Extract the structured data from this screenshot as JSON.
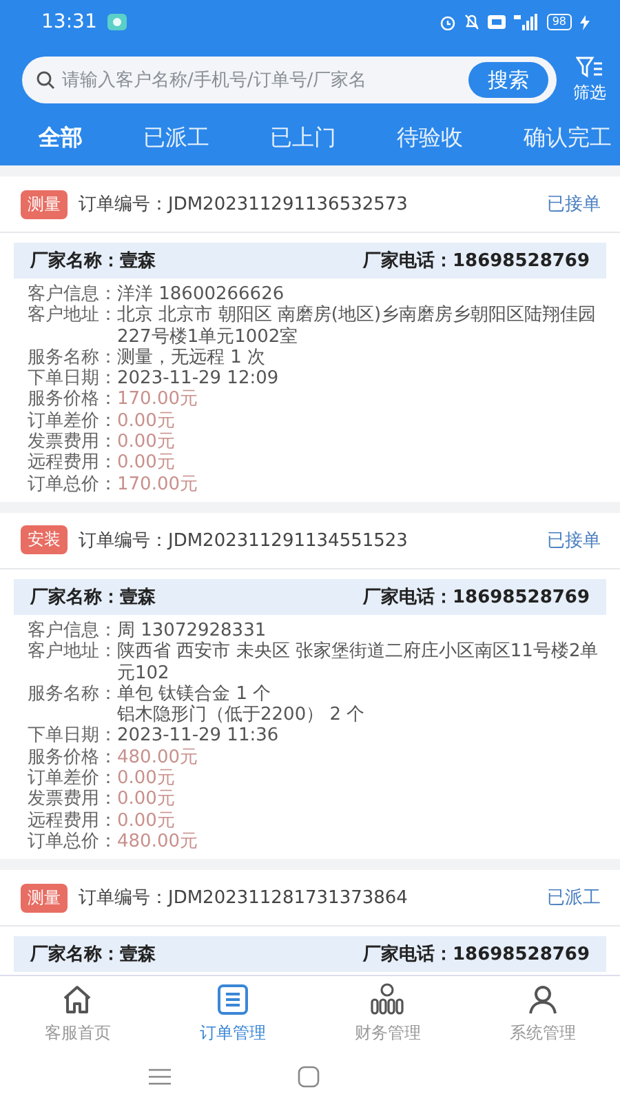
{
  "status_bar": {
    "time": "13:31",
    "battery": "98"
  },
  "search": {
    "placeholder": "请输入客户名称/手机号/订单号/厂家名",
    "button": "搜索",
    "filter_label": "筛选"
  },
  "tabs": [
    {
      "label": "全部",
      "selected": true
    },
    {
      "label": "已派工",
      "selected": false
    },
    {
      "label": "已上门",
      "selected": false
    },
    {
      "label": "待验收",
      "selected": false
    },
    {
      "label": "确认完工",
      "selected": false
    }
  ],
  "orders": [
    {
      "tag": "测量",
      "order_label": "订单编号：",
      "order_no": "JDM202311291136532573",
      "status": "已接单",
      "vendor_label": "厂家名称：",
      "vendor": "壹森",
      "phone_label": "厂家电话：",
      "phone": "18698528769",
      "details": [
        {
          "label": "客户信息：",
          "kind": "text",
          "lines": [
            "洋洋 18600266626"
          ]
        },
        {
          "label": "客户地址：",
          "kind": "text",
          "lines": [
            "北京 北京市 朝阳区 南磨房(地区)乡南磨房乡朝阳区陆翔佳园227号楼1单元1002室"
          ]
        },
        {
          "label": "服务名称：",
          "kind": "text",
          "lines": [
            "测量，无远程 1 次"
          ]
        },
        {
          "label": "下单日期：",
          "kind": "text",
          "lines": [
            "2023-11-29 12:09"
          ]
        },
        {
          "label": "服务价格：",
          "kind": "price",
          "lines": [
            "170.00元"
          ]
        },
        {
          "label": "订单差价：",
          "kind": "price",
          "lines": [
            "0.00元"
          ]
        },
        {
          "label": "发票费用：",
          "kind": "price",
          "lines": [
            "0.00元"
          ]
        },
        {
          "label": "远程费用：",
          "kind": "price",
          "lines": [
            "0.00元"
          ]
        },
        {
          "label": "订单总价：",
          "kind": "price",
          "lines": [
            "170.00元"
          ]
        }
      ]
    },
    {
      "tag": "安装",
      "order_label": "订单编号：",
      "order_no": "JDM202311291134551523",
      "status": "已接单",
      "vendor_label": "厂家名称：",
      "vendor": "壹森",
      "phone_label": "厂家电话：",
      "phone": "18698528769",
      "details": [
        {
          "label": "客户信息：",
          "kind": "text",
          "lines": [
            "周 13072928331"
          ]
        },
        {
          "label": "客户地址：",
          "kind": "text",
          "lines": [
            "陕西省 西安市 未央区 张家堡街道二府庄小区南区11号楼2单元102"
          ]
        },
        {
          "label": "服务名称：",
          "kind": "text",
          "lines": [
            "单包 钛镁合金 1 个",
            "铝木隐形门（低于2200） 2 个"
          ]
        },
        {
          "label": "下单日期：",
          "kind": "text",
          "lines": [
            "2023-11-29 11:36"
          ]
        },
        {
          "label": "服务价格：",
          "kind": "price",
          "lines": [
            "480.00元"
          ]
        },
        {
          "label": "订单差价：",
          "kind": "price",
          "lines": [
            "0.00元"
          ]
        },
        {
          "label": "发票费用：",
          "kind": "price",
          "lines": [
            "0.00元"
          ]
        },
        {
          "label": "远程费用：",
          "kind": "price",
          "lines": [
            "0.00元"
          ]
        },
        {
          "label": "订单总价：",
          "kind": "price",
          "lines": [
            "480.00元"
          ]
        }
      ]
    },
    {
      "tag": "测量",
      "order_label": "订单编号：",
      "order_no": "JDM202311281731373864",
      "status": "已派工",
      "vendor_label": "厂家名称：",
      "vendor": "壹森",
      "phone_label": "厂家电话：",
      "phone": "18698528769"
    }
  ],
  "bottom_nav": [
    {
      "label": "客服首页",
      "kind": "home",
      "selected": false
    },
    {
      "label": "订单管理",
      "kind": "orders",
      "selected": true
    },
    {
      "label": "财务管理",
      "kind": "finance",
      "selected": false
    },
    {
      "label": "系统管理",
      "kind": "user",
      "selected": false
    }
  ]
}
